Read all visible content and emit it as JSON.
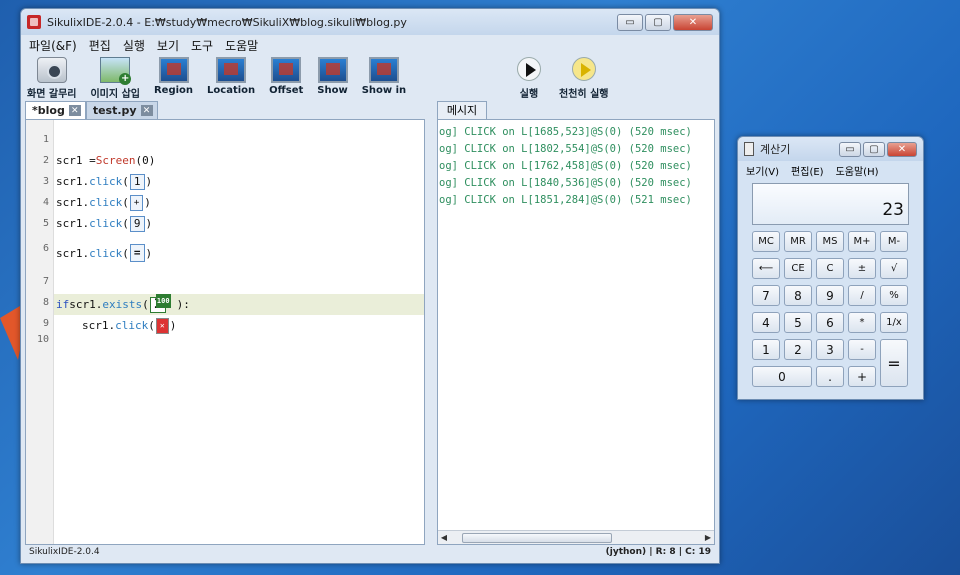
{
  "window": {
    "title": "SikulixIDE-2.0.4 - E:₩study₩mecro₩SikuliX₩blog.sikuli₩blog.py",
    "min_label": "▭",
    "max_label": "▢",
    "close_label": "✕"
  },
  "menu": [
    "파일(&F)",
    "편집",
    "실행",
    "보기",
    "도구",
    "도움말"
  ],
  "toolbar": {
    "capture": "화면 갈무리",
    "insert_image": "이미지 삽입",
    "region": "Region",
    "location": "Location",
    "offset": "Offset",
    "show": "Show",
    "show_in": "Show in",
    "run": "실행",
    "run_slow": "천천히 실행"
  },
  "tabs": [
    {
      "label": "*blog",
      "close": "✕"
    },
    {
      "label": "test.py",
      "close": "✕"
    }
  ],
  "editor": {
    "line_numbers": [
      "1",
      "2",
      "3",
      "4",
      "5",
      "6",
      "7",
      "8",
      "9",
      "10"
    ],
    "lines": {
      "l2_var": "scr1 = ",
      "l2_cls": "Screen",
      "l2_arg": "(0)",
      "click_prefix": "scr1.",
      "click_fn": "click",
      "open": "(",
      "close": ")",
      "img1": "1",
      "img_plus": "+",
      "img9": "9",
      "img_eq": "=",
      "if_kw": "if",
      "if_obj": " scr1.",
      "exists_fn": "exists",
      "img_calc1": "1",
      "colon": "):",
      "inner_prefix": "scr1.",
      "img_close": "✕"
    }
  },
  "messages": {
    "tab_label": "메시지",
    "lines": [
      "og] CLICK on L[1685,523]@S(0) (520 msec)",
      "og] CLICK on L[1802,554]@S(0) (520 msec)",
      "og] CLICK on L[1762,458]@S(0) (520 msec)",
      "og] CLICK on L[1840,536]@S(0) (520 msec)",
      "og] CLICK on L[1851,284]@S(0) (521 msec)"
    ],
    "scroll_left": "◀",
    "scroll_right": "▶"
  },
  "status": {
    "left": "SikulixIDE-2.0.4",
    "right": "(jython) | R: 8 | C: 19"
  },
  "calculator": {
    "title": "계산기",
    "menu": [
      "보기(V)",
      "편집(E)",
      "도움말(H)"
    ],
    "display": "23",
    "keys": {
      "mc": "MC",
      "mr": "MR",
      "ms": "MS",
      "mplus": "M+",
      "mminus": "M-",
      "back": "⟵",
      "ce": "CE",
      "c": "C",
      "pm": "±",
      "sqrt": "√",
      "k7": "7",
      "k8": "8",
      "k9": "9",
      "div": "/",
      "pct": "%",
      "k4": "4",
      "k5": "5",
      "k6": "6",
      "mul": "*",
      "inv": "1/x",
      "k1": "1",
      "k2": "2",
      "k3": "3",
      "sub": "-",
      "eq": "=",
      "k0": "0",
      "dot": ".",
      "add": "+"
    }
  }
}
